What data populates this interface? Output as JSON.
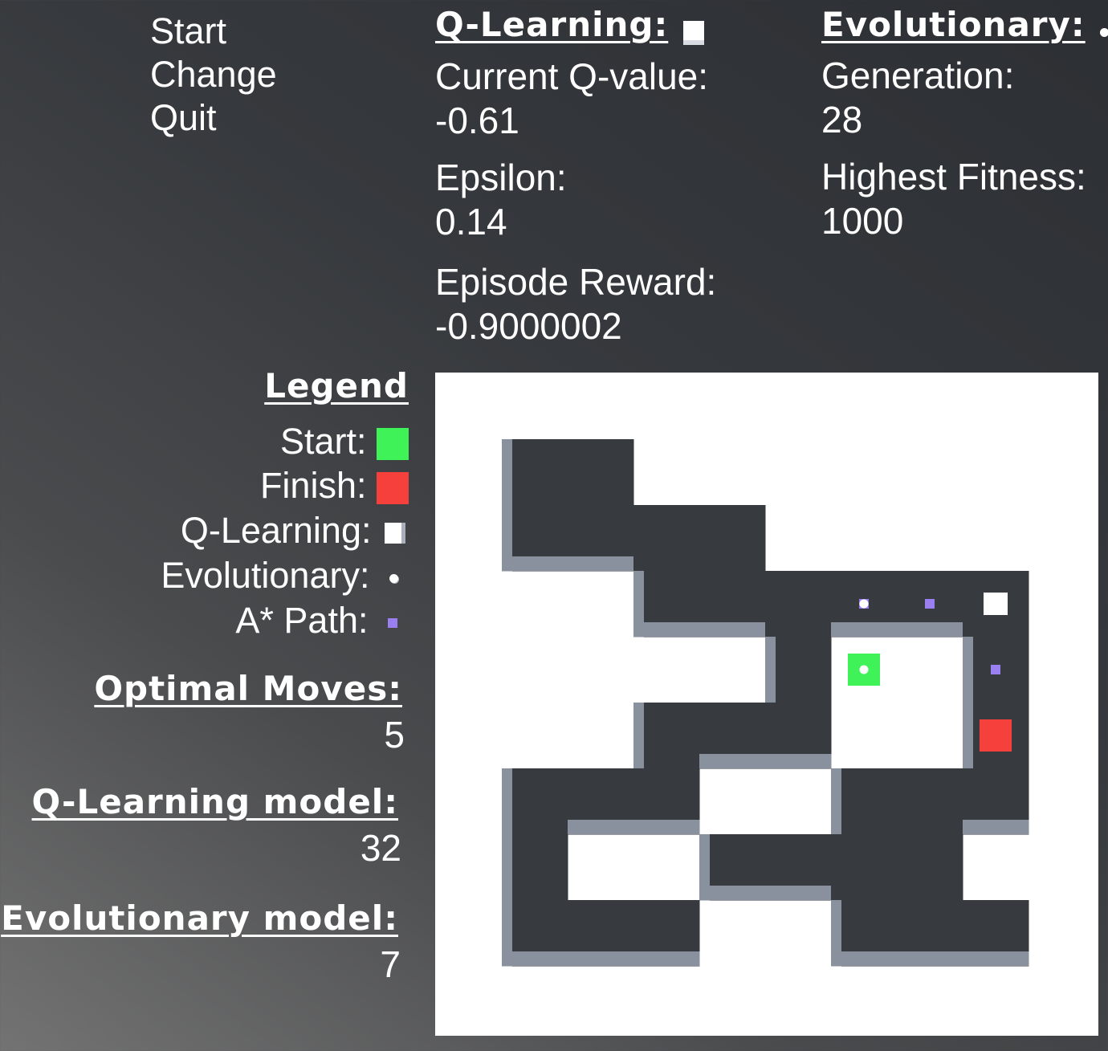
{
  "menu": {
    "items": [
      "Start",
      "Change",
      "Quit"
    ]
  },
  "qlearning": {
    "title": "Q-Learning:",
    "stats": [
      {
        "label": "Current Q-value:",
        "value": "-0.61"
      },
      {
        "label": "Epsilon:",
        "value": "0.14"
      },
      {
        "label": "Episode Reward:",
        "value": "-0.9000002"
      }
    ]
  },
  "evolutionary": {
    "title": "Evolutionary:",
    "stats": [
      {
        "label": "Generation:",
        "value": "28"
      },
      {
        "label": "Highest Fitness:",
        "value": "1000"
      }
    ]
  },
  "legend": {
    "title": "Legend",
    "items": [
      {
        "label": "Start:",
        "color": "#3ff258"
      },
      {
        "label": "Finish:",
        "color": "#f5403c"
      },
      {
        "label": "Q-Learning:",
        "color": "#ffffff"
      },
      {
        "label": "Evolutionary:",
        "color": "#ffffff"
      },
      {
        "label": "A* Path:",
        "color": "#9a7ff0"
      }
    ]
  },
  "optimal_moves": {
    "title": "Optimal Moves:",
    "value": "5"
  },
  "qlearning_model": {
    "title": "Q-Learning model:",
    "value": "32"
  },
  "evolutionary_model": {
    "title": "Evolutionary model:",
    "value": "7"
  },
  "maze": {
    "floor_color": "#373a3e",
    "wall_color": "#ffffff",
    "wall_side_color": "#8a919e",
    "cols": 8,
    "rows": 8,
    "floor_rows": [
      "11......",
      "1111....",
      "..111111",
      "....#..1",
      "..111..1",
      "111..111",
      "1..1111.",
      "111..111"
    ],
    "start": {
      "col": 5,
      "row": 3
    },
    "finish": {
      "col": 7,
      "row": 4
    },
    "qlearning_agent": {
      "col": 7,
      "row": 2
    },
    "evolutionary_agents": [
      {
        "col": 5,
        "row": 2
      },
      {
        "col": 5,
        "row": 3
      }
    ],
    "astar_path": [
      {
        "col": 5,
        "row": 2
      },
      {
        "col": 6,
        "row": 2
      },
      {
        "col": 7,
        "row": 3
      }
    ]
  }
}
